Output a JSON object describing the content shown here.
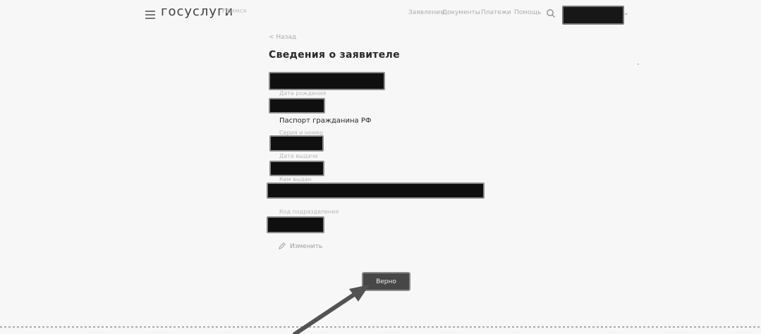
{
  "header": {
    "logo": "госуслуги",
    "region": "Уфимск",
    "nav": [
      "Заявления",
      "Документы",
      "Платежи",
      "Помощь"
    ]
  },
  "main": {
    "back_link": "< Назад",
    "title": "Сведения о заявителе",
    "fields": {
      "birth_date_label": "Дата рождения",
      "passport_title": "Паспорт гражданина РФ",
      "series_number_label": "Серия и номер",
      "issue_date_label": "Дата выдачи",
      "issued_by_label": "Кем выдан",
      "division_code_label": "Код подразделения"
    },
    "edit_label": "Изменить",
    "confirm_button": "Верно"
  },
  "colors": {
    "redaction": "#141414",
    "button": "#4a4a4a",
    "arrow": "#555555"
  },
  "icons": [
    "hamburger-icon",
    "search-icon",
    "chevron-down-icon",
    "pencil-icon",
    "pointer-arrow"
  ]
}
